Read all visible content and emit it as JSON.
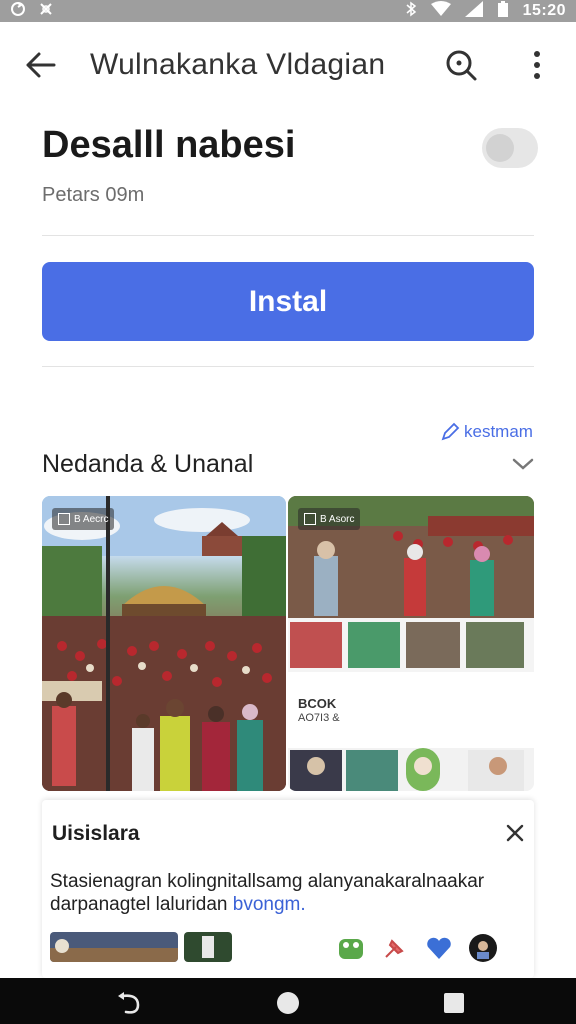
{
  "status_bar": {
    "time": "15:20",
    "icons": [
      "sync-icon",
      "settings-icon",
      "bluetooth-icon",
      "wifi-icon",
      "signal-icon",
      "battery-icon"
    ]
  },
  "app_bar": {
    "title": "Wulnakanka Vldagian",
    "icons": [
      "back-arrow-icon",
      "search-icon",
      "more-vert-icon"
    ]
  },
  "app": {
    "name": "Desalll nabesi",
    "meta": "Petars 09m",
    "toggle_on": false
  },
  "install": {
    "label": "Instal"
  },
  "section": {
    "link_label": "kestmam",
    "title": "Nedanda & Unanal"
  },
  "screenshots": [
    {
      "badge": "B Aecrc"
    },
    {
      "badge": "B Asorc",
      "caption_title": "BCOK",
      "caption_sub": "AO7I3 &"
    }
  ],
  "dialog": {
    "title": "Uisislara",
    "body_line1": "Stasienagran kolingnitallsamg alanyanakaralnaakar",
    "body_line2_prefix": "darpanagtel laluridan ",
    "body_link": "bvongm.",
    "icons": [
      "frog-app-icon",
      "pin-icon",
      "heart-icon",
      "avatar-icon"
    ]
  },
  "nav_bar": {
    "icons": [
      "back-nav-icon",
      "home-nav-icon",
      "recents-nav-icon"
    ]
  },
  "colors": {
    "accent": "#4a6ee5",
    "status_bar": "#9e9e9e",
    "nav_bar": "#0a0a0a",
    "link": "#3b62d6"
  }
}
